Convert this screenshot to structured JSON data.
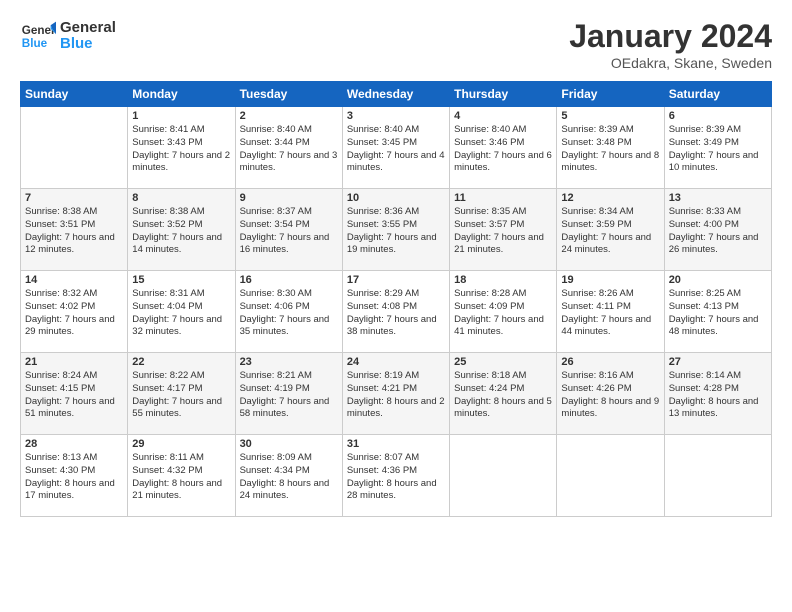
{
  "header": {
    "logo_general": "General",
    "logo_blue": "Blue",
    "title": "January 2024",
    "subtitle": "OEdakra, Skane, Sweden"
  },
  "days_of_week": [
    "Sunday",
    "Monday",
    "Tuesday",
    "Wednesday",
    "Thursday",
    "Friday",
    "Saturday"
  ],
  "weeks": [
    [
      {
        "day": "",
        "sunrise": "",
        "sunset": "",
        "daylight": ""
      },
      {
        "day": "1",
        "sunrise": "Sunrise: 8:41 AM",
        "sunset": "Sunset: 3:43 PM",
        "daylight": "Daylight: 7 hours and 2 minutes."
      },
      {
        "day": "2",
        "sunrise": "Sunrise: 8:40 AM",
        "sunset": "Sunset: 3:44 PM",
        "daylight": "Daylight: 7 hours and 3 minutes."
      },
      {
        "day": "3",
        "sunrise": "Sunrise: 8:40 AM",
        "sunset": "Sunset: 3:45 PM",
        "daylight": "Daylight: 7 hours and 4 minutes."
      },
      {
        "day": "4",
        "sunrise": "Sunrise: 8:40 AM",
        "sunset": "Sunset: 3:46 PM",
        "daylight": "Daylight: 7 hours and 6 minutes."
      },
      {
        "day": "5",
        "sunrise": "Sunrise: 8:39 AM",
        "sunset": "Sunset: 3:48 PM",
        "daylight": "Daylight: 7 hours and 8 minutes."
      },
      {
        "day": "6",
        "sunrise": "Sunrise: 8:39 AM",
        "sunset": "Sunset: 3:49 PM",
        "daylight": "Daylight: 7 hours and 10 minutes."
      }
    ],
    [
      {
        "day": "7",
        "sunrise": "Sunrise: 8:38 AM",
        "sunset": "Sunset: 3:51 PM",
        "daylight": "Daylight: 7 hours and 12 minutes."
      },
      {
        "day": "8",
        "sunrise": "Sunrise: 8:38 AM",
        "sunset": "Sunset: 3:52 PM",
        "daylight": "Daylight: 7 hours and 14 minutes."
      },
      {
        "day": "9",
        "sunrise": "Sunrise: 8:37 AM",
        "sunset": "Sunset: 3:54 PM",
        "daylight": "Daylight: 7 hours and 16 minutes."
      },
      {
        "day": "10",
        "sunrise": "Sunrise: 8:36 AM",
        "sunset": "Sunset: 3:55 PM",
        "daylight": "Daylight: 7 hours and 19 minutes."
      },
      {
        "day": "11",
        "sunrise": "Sunrise: 8:35 AM",
        "sunset": "Sunset: 3:57 PM",
        "daylight": "Daylight: 7 hours and 21 minutes."
      },
      {
        "day": "12",
        "sunrise": "Sunrise: 8:34 AM",
        "sunset": "Sunset: 3:59 PM",
        "daylight": "Daylight: 7 hours and 24 minutes."
      },
      {
        "day": "13",
        "sunrise": "Sunrise: 8:33 AM",
        "sunset": "Sunset: 4:00 PM",
        "daylight": "Daylight: 7 hours and 26 minutes."
      }
    ],
    [
      {
        "day": "14",
        "sunrise": "Sunrise: 8:32 AM",
        "sunset": "Sunset: 4:02 PM",
        "daylight": "Daylight: 7 hours and 29 minutes."
      },
      {
        "day": "15",
        "sunrise": "Sunrise: 8:31 AM",
        "sunset": "Sunset: 4:04 PM",
        "daylight": "Daylight: 7 hours and 32 minutes."
      },
      {
        "day": "16",
        "sunrise": "Sunrise: 8:30 AM",
        "sunset": "Sunset: 4:06 PM",
        "daylight": "Daylight: 7 hours and 35 minutes."
      },
      {
        "day": "17",
        "sunrise": "Sunrise: 8:29 AM",
        "sunset": "Sunset: 4:08 PM",
        "daylight": "Daylight: 7 hours and 38 minutes."
      },
      {
        "day": "18",
        "sunrise": "Sunrise: 8:28 AM",
        "sunset": "Sunset: 4:09 PM",
        "daylight": "Daylight: 7 hours and 41 minutes."
      },
      {
        "day": "19",
        "sunrise": "Sunrise: 8:26 AM",
        "sunset": "Sunset: 4:11 PM",
        "daylight": "Daylight: 7 hours and 44 minutes."
      },
      {
        "day": "20",
        "sunrise": "Sunrise: 8:25 AM",
        "sunset": "Sunset: 4:13 PM",
        "daylight": "Daylight: 7 hours and 48 minutes."
      }
    ],
    [
      {
        "day": "21",
        "sunrise": "Sunrise: 8:24 AM",
        "sunset": "Sunset: 4:15 PM",
        "daylight": "Daylight: 7 hours and 51 minutes."
      },
      {
        "day": "22",
        "sunrise": "Sunrise: 8:22 AM",
        "sunset": "Sunset: 4:17 PM",
        "daylight": "Daylight: 7 hours and 55 minutes."
      },
      {
        "day": "23",
        "sunrise": "Sunrise: 8:21 AM",
        "sunset": "Sunset: 4:19 PM",
        "daylight": "Daylight: 7 hours and 58 minutes."
      },
      {
        "day": "24",
        "sunrise": "Sunrise: 8:19 AM",
        "sunset": "Sunset: 4:21 PM",
        "daylight": "Daylight: 8 hours and 2 minutes."
      },
      {
        "day": "25",
        "sunrise": "Sunrise: 8:18 AM",
        "sunset": "Sunset: 4:24 PM",
        "daylight": "Daylight: 8 hours and 5 minutes."
      },
      {
        "day": "26",
        "sunrise": "Sunrise: 8:16 AM",
        "sunset": "Sunset: 4:26 PM",
        "daylight": "Daylight: 8 hours and 9 minutes."
      },
      {
        "day": "27",
        "sunrise": "Sunrise: 8:14 AM",
        "sunset": "Sunset: 4:28 PM",
        "daylight": "Daylight: 8 hours and 13 minutes."
      }
    ],
    [
      {
        "day": "28",
        "sunrise": "Sunrise: 8:13 AM",
        "sunset": "Sunset: 4:30 PM",
        "daylight": "Daylight: 8 hours and 17 minutes."
      },
      {
        "day": "29",
        "sunrise": "Sunrise: 8:11 AM",
        "sunset": "Sunset: 4:32 PM",
        "daylight": "Daylight: 8 hours and 21 minutes."
      },
      {
        "day": "30",
        "sunrise": "Sunrise: 8:09 AM",
        "sunset": "Sunset: 4:34 PM",
        "daylight": "Daylight: 8 hours and 24 minutes."
      },
      {
        "day": "31",
        "sunrise": "Sunrise: 8:07 AM",
        "sunset": "Sunset: 4:36 PM",
        "daylight": "Daylight: 8 hours and 28 minutes."
      },
      {
        "day": "",
        "sunrise": "",
        "sunset": "",
        "daylight": ""
      },
      {
        "day": "",
        "sunrise": "",
        "sunset": "",
        "daylight": ""
      },
      {
        "day": "",
        "sunrise": "",
        "sunset": "",
        "daylight": ""
      }
    ]
  ]
}
